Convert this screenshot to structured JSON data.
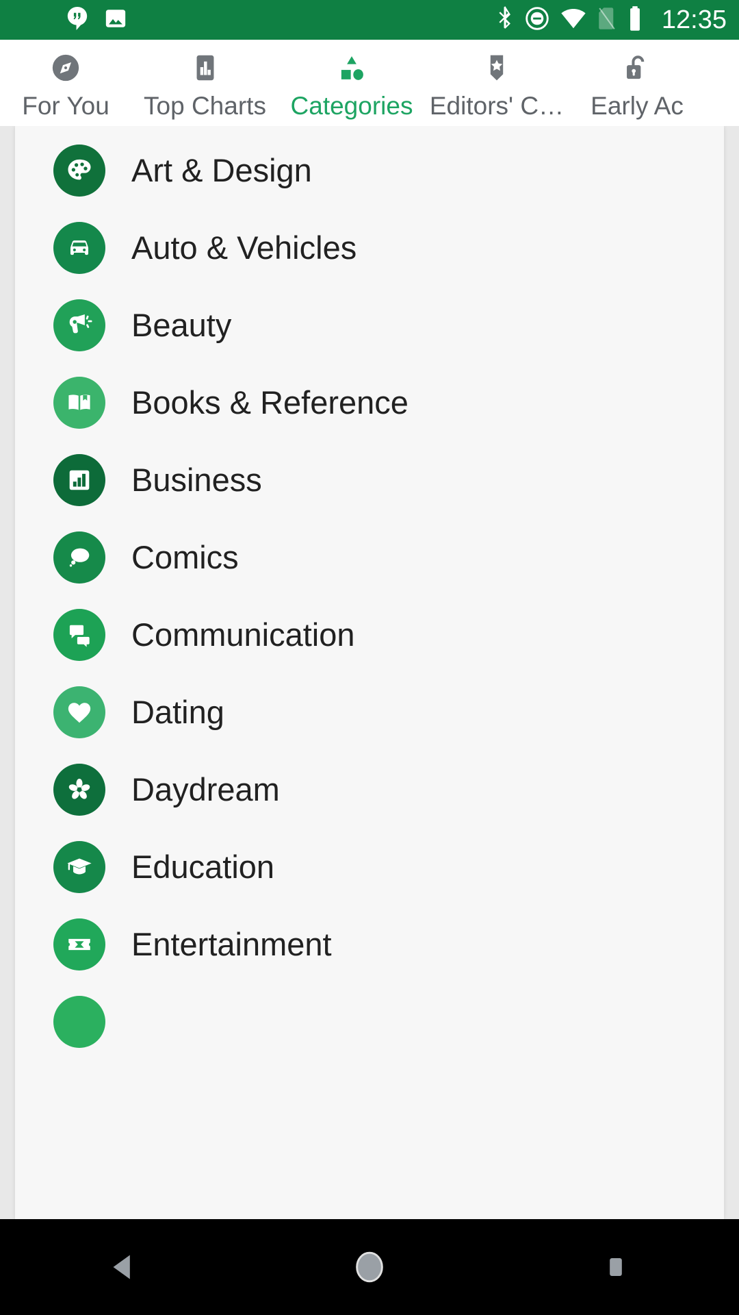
{
  "statusbar": {
    "time": "12:35",
    "background": "#0f8043",
    "left_icons": [
      {
        "name": "hangouts-icon"
      },
      {
        "name": "photo-icon"
      }
    ],
    "right_icons": [
      {
        "name": "bluetooth-icon"
      },
      {
        "name": "do-not-disturb-icon"
      },
      {
        "name": "wifi-icon"
      },
      {
        "name": "no-sim-icon"
      },
      {
        "name": "battery-icon"
      }
    ]
  },
  "tabs": {
    "active": "Categories",
    "active_color": "#1da462",
    "inactive_color": "#5f6368",
    "items": [
      {
        "label": "For You",
        "icon": "compass-icon"
      },
      {
        "label": "Top Charts",
        "icon": "bar-chart-icon"
      },
      {
        "label": "Categories",
        "icon": "shapes-icon"
      },
      {
        "label": "Editors' C…",
        "icon": "badge-star-icon"
      },
      {
        "label": "Early Ac",
        "icon": "open-lock-icon"
      }
    ]
  },
  "categories": {
    "items": [
      {
        "label": "Art & Design",
        "icon": "palette-icon",
        "color": "#10713b"
      },
      {
        "label": "Auto & Vehicles",
        "icon": "car-icon",
        "color": "#14884b"
      },
      {
        "label": "Beauty",
        "icon": "hair-dryer-icon",
        "color": "#21a158"
      },
      {
        "label": "Books & Reference",
        "icon": "open-book-icon",
        "color": "#3bb46c"
      },
      {
        "label": "Business",
        "icon": "bar-chart-icon",
        "color": "#0d6b39"
      },
      {
        "label": "Comics",
        "icon": "thought-bubble-icon",
        "color": "#168a4a"
      },
      {
        "label": "Communication",
        "icon": "chat-bubbles-icon",
        "color": "#1da255"
      },
      {
        "label": "Dating",
        "icon": "heart-icon",
        "color": "#3cb371"
      },
      {
        "label": "Daydream",
        "icon": "pinwheel-icon",
        "color": "#0e6f3c"
      },
      {
        "label": "Education",
        "icon": "graduation-cap-icon",
        "color": "#15884a"
      },
      {
        "label": "Entertainment",
        "icon": "ticket-icon",
        "color": "#21a85a"
      }
    ]
  },
  "navbar": {
    "buttons": [
      {
        "name": "back-button",
        "icon": "triangle-left-icon"
      },
      {
        "name": "home-button",
        "icon": "circle-icon"
      },
      {
        "name": "recents-button",
        "icon": "square-icon"
      }
    ]
  }
}
